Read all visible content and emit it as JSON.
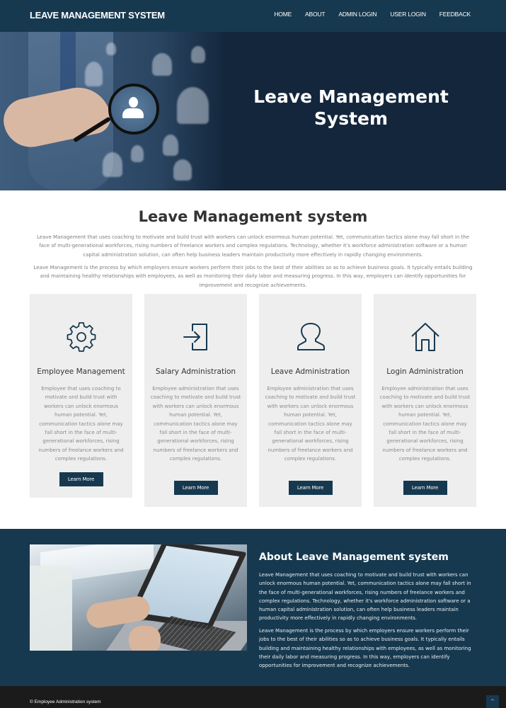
{
  "header": {
    "brand": "LEAVE MANAGEMENT SYSTEM",
    "nav": [
      "HOME",
      "ABOUT",
      "ADMIN LOGIN",
      "USER LOGIN",
      "FEEDBACK"
    ]
  },
  "hero": {
    "title": "Leave Management System",
    "image_icon": "magnifier-person-icon"
  },
  "intro": {
    "title": "Leave Management system",
    "paragraphs": [
      "Leave Management that uses coaching to motivate and build trust with workers can unlock enormous human potential. Yet, communication tactics alone may fall short in the face of multi-generational workforces, rising numbers of freelance workers and complex regulations. Technology, whether it's workforce administration software or a human capital administration solution, can often help business leaders maintain productivity more effectively in rapidly changing environments.",
      "Leave Management is the process by which employers ensure workers perform their jobs to the best of their abilities so as to achieve business goals. It typically entails building and maintaining healthy relationships with employees, as well as monitoring their daily labor and measuring progress. In this way, employers can identify opportunities for improvement and recognize achievements."
    ]
  },
  "cards": [
    {
      "icon": "gear-icon",
      "title": "Employee Management",
      "text": "Employee that uses coaching to motivate and build trust with workers can unlock enormous human potential. Yet, communication tactics alone may fall short in the face of multi-generational workforces, rising numbers of freelance workers and complex regulations.",
      "button": "Learn More"
    },
    {
      "icon": "sign-in-icon",
      "title": "Salary Administration",
      "text": "Employee administration that uses coaching to motivate and build trust with workers can unlock enormous human potential. Yet, communication tactics alone may fall short in the face of multi-generational workforces, rising numbers of freelance workers and complex regulations.",
      "button": "Learn More"
    },
    {
      "icon": "user-icon",
      "title": "Leave Administration",
      "text": "Employee administration that uses coaching to motivate and build trust with workers can unlock enormous human potential. Yet, communication tactics alone may fall short in the face of multi-generational workforces, rising numbers of freelance workers and complex regulations.",
      "button": "Learn More"
    },
    {
      "icon": "home-icon",
      "title": "Login Administration",
      "text": "Employee administration that uses coaching to motivate and build trust with workers can unlock enormous human potential. Yet, communication tactics alone may fall short in the face of multi-generational workforces, rising numbers of freelance workers and complex regulations.",
      "button": "Learn More"
    }
  ],
  "about": {
    "title": "About Leave Management system",
    "paragraphs": [
      "Leave Management that uses coaching to motivate and build trust with workers can unlock enormous human potential. Yet, communication tactics alone may fall short in the face of multi-generational workforces, rising numbers of freelance workers and complex regulations. Technology, whether it's workforce administration software or a human capital administration solution, can often help business leaders maintain productivity more effectively in rapidly changing environments.",
      "Leave Management is the process by which employers ensure workers perform their jobs to the best of their abilities so as to achieve business goals. It typically entails building and maintaining healthy relationships with employees, as well as monitoring their daily labor and measuring progress. In this way, employers can identify opportunities for improvement and recognize achievements."
    ],
    "image": "laptop-typing-photo"
  },
  "footer": {
    "copyright": "© Employee Administration system",
    "to_top": "^"
  },
  "colors": {
    "primary": "#17394f",
    "hero_bg": "#13263b",
    "card_bg": "#eeeeee",
    "footer_bg": "#1b1b1b"
  }
}
